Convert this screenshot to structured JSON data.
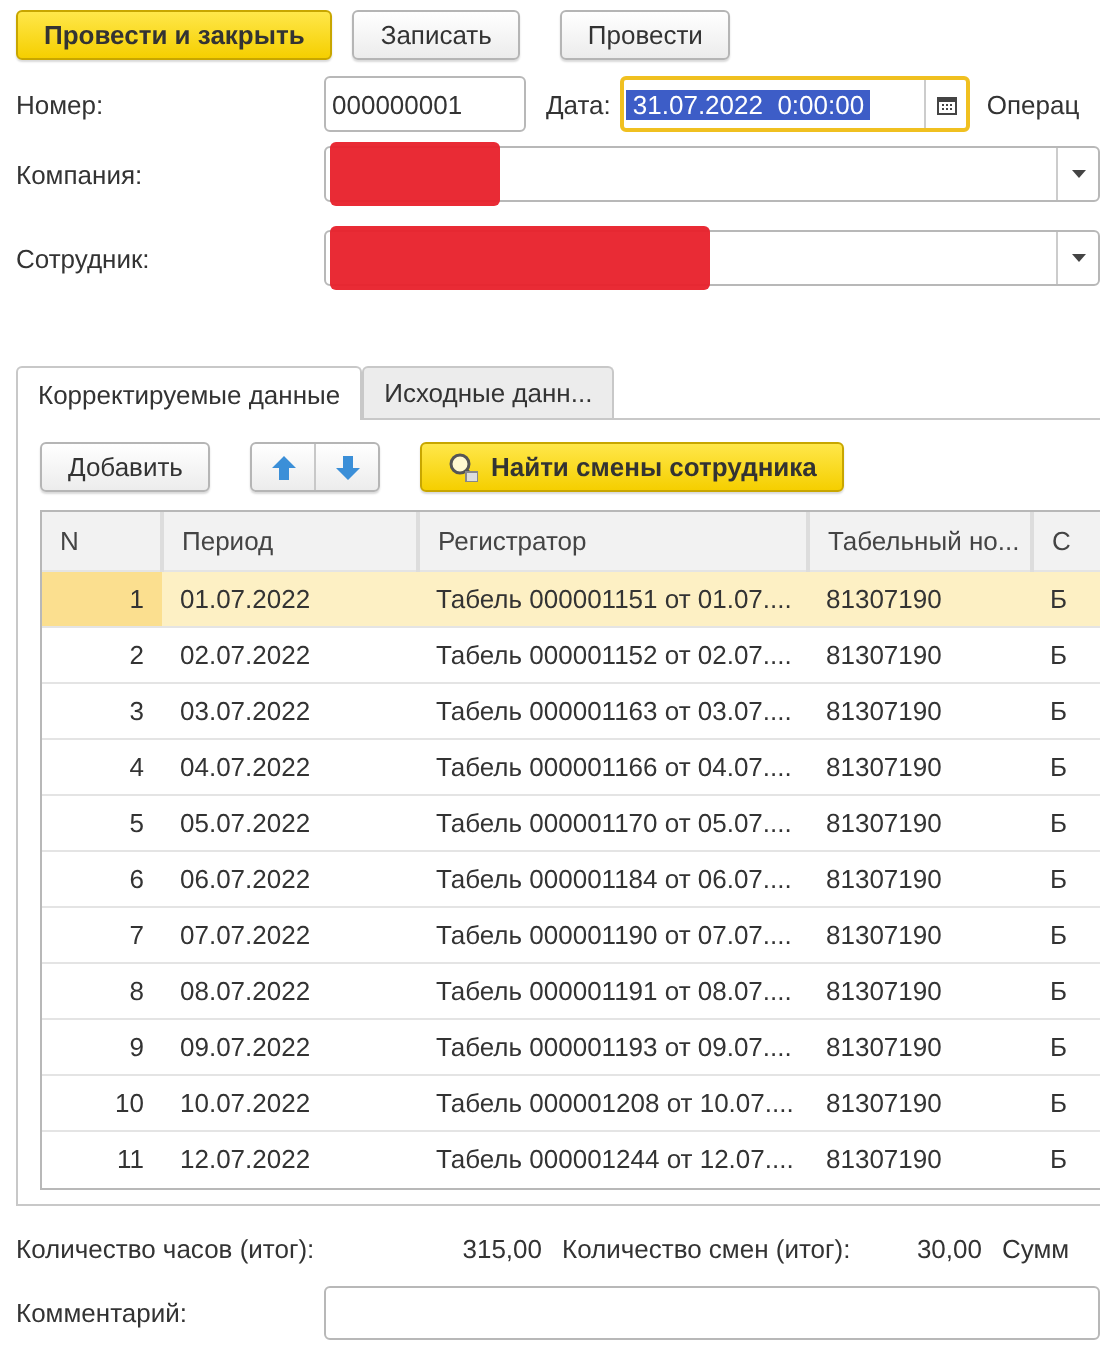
{
  "toolbar": {
    "buttons": [
      {
        "label": "Провести и закрыть",
        "kind": "primary"
      },
      {
        "label": "Записать",
        "kind": "normal"
      },
      {
        "label": "Провести",
        "kind": "normal"
      }
    ]
  },
  "fields": {
    "number": {
      "label": "Номер:",
      "value": "000000001"
    },
    "date": {
      "label": "Дата:",
      "value": "31.07.2022  0:00:00",
      "focused": true
    },
    "operation_label": "Операц",
    "company": {
      "label": "Компания:",
      "redacted": true
    },
    "employee": {
      "label": "Сотрудник:",
      "redacted": true
    }
  },
  "tabs": [
    {
      "label": "Корректируемые данные",
      "selected": true
    },
    {
      "label": "Исходные данн...",
      "selected": false
    }
  ],
  "table_toolbar": {
    "add": "Добавить",
    "find": "Найти смены сотрудника"
  },
  "table": {
    "columns": [
      "N",
      "Период",
      "Регистратор",
      "Табельный но...",
      "С"
    ],
    "rows": [
      {
        "cells": [
          "1",
          "01.07.2022",
          "Табель 000001151 от 01.07....",
          "81307190",
          "Б"
        ],
        "selected": true
      },
      {
        "cells": [
          "2",
          "02.07.2022",
          "Табель 000001152 от 02.07....",
          "81307190",
          "Б"
        ],
        "selected": false
      },
      {
        "cells": [
          "3",
          "03.07.2022",
          "Табель 000001163 от 03.07....",
          "81307190",
          "Б"
        ],
        "selected": false
      },
      {
        "cells": [
          "4",
          "04.07.2022",
          "Табель 000001166 от 04.07....",
          "81307190",
          "Б"
        ],
        "selected": false
      },
      {
        "cells": [
          "5",
          "05.07.2022",
          "Табель 000001170 от 05.07....",
          "81307190",
          "Б"
        ],
        "selected": false
      },
      {
        "cells": [
          "6",
          "06.07.2022",
          "Табель 000001184 от 06.07....",
          "81307190",
          "Б"
        ],
        "selected": false
      },
      {
        "cells": [
          "7",
          "07.07.2022",
          "Табель 000001190 от 07.07....",
          "81307190",
          "Б"
        ],
        "selected": false
      },
      {
        "cells": [
          "8",
          "08.07.2022",
          "Табель 000001191 от 08.07....",
          "81307190",
          "Б"
        ],
        "selected": false
      },
      {
        "cells": [
          "9",
          "09.07.2022",
          "Табель 000001193 от 09.07....",
          "81307190",
          "Б"
        ],
        "selected": false
      },
      {
        "cells": [
          "10",
          "10.07.2022",
          "Табель 000001208 от 10.07....",
          "81307190",
          "Б"
        ],
        "selected": false
      },
      {
        "cells": [
          "11",
          "12.07.2022",
          "Табель 000001244 от 12.07....",
          "81307190",
          "Б"
        ],
        "selected": false
      }
    ]
  },
  "totals": [
    {
      "label": "Количество часов (итог):",
      "value": "315,00"
    },
    {
      "label": "Количество смен (итог):",
      "value": "30,00"
    },
    {
      "label": "Сумм"
    }
  ],
  "comment": {
    "label": "Комментарий:"
  }
}
